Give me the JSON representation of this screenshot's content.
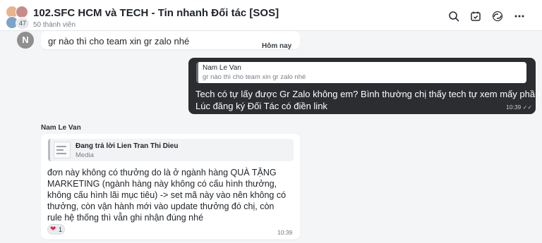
{
  "header": {
    "title": "102.SFC HCM và TECH - Tin nhanh Đối tác [SOS]",
    "member_count": "50 thành viên",
    "avatar_overflow": "47",
    "icons": [
      "search-icon",
      "calendar-check-icon",
      "thread-icon",
      "more-icon"
    ]
  },
  "messages": [
    {
      "avatar_letter": "N",
      "text": "gr nào thì cho team xin gr zalo nhé",
      "date_separator": "Hôm nay"
    },
    {
      "quote_author": "Nam Le Van",
      "quote_text": "gr nào thì cho team xin gr zalo nhé",
      "line1": "Tech có tự lấy được Gr Zalo không em? Bình thường chị thấy tech tự xem mấy phần này.",
      "line2": "Lúc đăng ký Đối Tác có điền link",
      "time": "10:39",
      "status_icon": "double-check-icon"
    },
    {
      "sender": "Nam Le Van",
      "quote_author": "Đang trả lời Lien Tran Thi Dieu",
      "quote_text": "Media",
      "body": "đơn này không có thưởng do là ở ngành hàng QUÀ TẶNG MARKETING  (ngành hàng này không có cấu hình thưởng, không cấu hình lãi mục tiêu) -> set mã này vào nên không có thưởng, còn vận hành mới vào update thưởng đó chị, còn rule hệ thống thì vẫn ghi nhận đúng nhé",
      "reaction_icon": "heart-icon",
      "reaction_count": "1",
      "time": "10:39"
    }
  ],
  "colors": {
    "outgoing_bubble": "#2b2d31",
    "incoming_bubble": "#ffffff",
    "background": "#f4f5f7",
    "reaction_heart": "#e0284a"
  }
}
